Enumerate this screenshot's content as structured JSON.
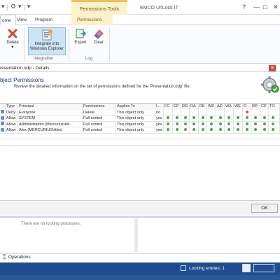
{
  "window": {
    "title": "EMCO UnLock IT",
    "contextual_tab_group": "Permissions Tools",
    "controls": {
      "help": "?",
      "minimize": "—",
      "maximize": "□",
      "close": "✕"
    }
  },
  "ribbon": {
    "tabs": [
      {
        "label": "ome",
        "active": true
      },
      {
        "label": "View",
        "active": false
      },
      {
        "label": "Program",
        "active": false
      },
      {
        "label": "Permissions",
        "active": false
      }
    ],
    "buttons": {
      "delete": "Delete",
      "integrate": "Integrate into Windows Explorer",
      "export": "Export",
      "clear": "Clear"
    },
    "groups": {
      "integration": "Integration",
      "log": "Log"
    }
  },
  "details": {
    "title": "resentation.odp - Details",
    "close": "✕",
    "header_title": "bject Permissions",
    "header_desc": "Review the detailed information on the set of permissions defined for the 'Presentation.odp' file."
  },
  "permissions_table": {
    "columns": [
      "Type",
      "Principal",
      "Permissions",
      "Applies To",
      "I...",
      "FC",
      "EP",
      "RD",
      "RA",
      "RE",
      "WD",
      "AD",
      "WA",
      "WE",
      "D",
      "RP",
      "CP",
      "TO"
    ],
    "rows": [
      {
        "type": "Deny",
        "principal": "Everyone",
        "permissions": "Delete",
        "applies_to": "This object only",
        "inherited": "no",
        "flags": [
          "",
          "",
          "",
          "",
          "",
          "",
          "",
          "",
          "",
          "red",
          "",
          "",
          ""
        ]
      },
      {
        "type": "Allow",
        "principal": "SYSTEM",
        "permissions": "Full control",
        "applies_to": "This object only",
        "inherited": "yes",
        "flags": [
          "green",
          "green",
          "green",
          "green",
          "green",
          "green",
          "green",
          "green",
          "green",
          "green",
          "green",
          "green",
          "green"
        ]
      },
      {
        "type": "Allow",
        "principal": "Administrators (Mercurius\\Ad...",
        "permissions": "Full control",
        "applies_to": "This object only",
        "inherited": "yes",
        "flags": [
          "green",
          "green",
          "green",
          "green",
          "green",
          "green",
          "green",
          "green",
          "green",
          "green",
          "green",
          "green",
          "green"
        ]
      },
      {
        "type": "Allow",
        "principal": "Alex (MERCURIUS\\Alex)",
        "permissions": "Full control",
        "applies_to": "This object only",
        "inherited": "yes",
        "flags": [
          "green",
          "green",
          "green",
          "green",
          "green",
          "green",
          "green",
          "green",
          "green",
          "green",
          "green",
          "green",
          "green"
        ]
      }
    ]
  },
  "footer": {
    "ok": "OK"
  },
  "lower": {
    "no_locking": "There are no locking processes."
  },
  "operations_tab": "Operations",
  "status": {
    "locking_entries": "Locking entries: 1"
  },
  "colors": {
    "allow_dot": "#45a845",
    "deny_dot": "#d9534f",
    "status_bar": "#2b5797",
    "context_tab": "#fdf1cc"
  }
}
